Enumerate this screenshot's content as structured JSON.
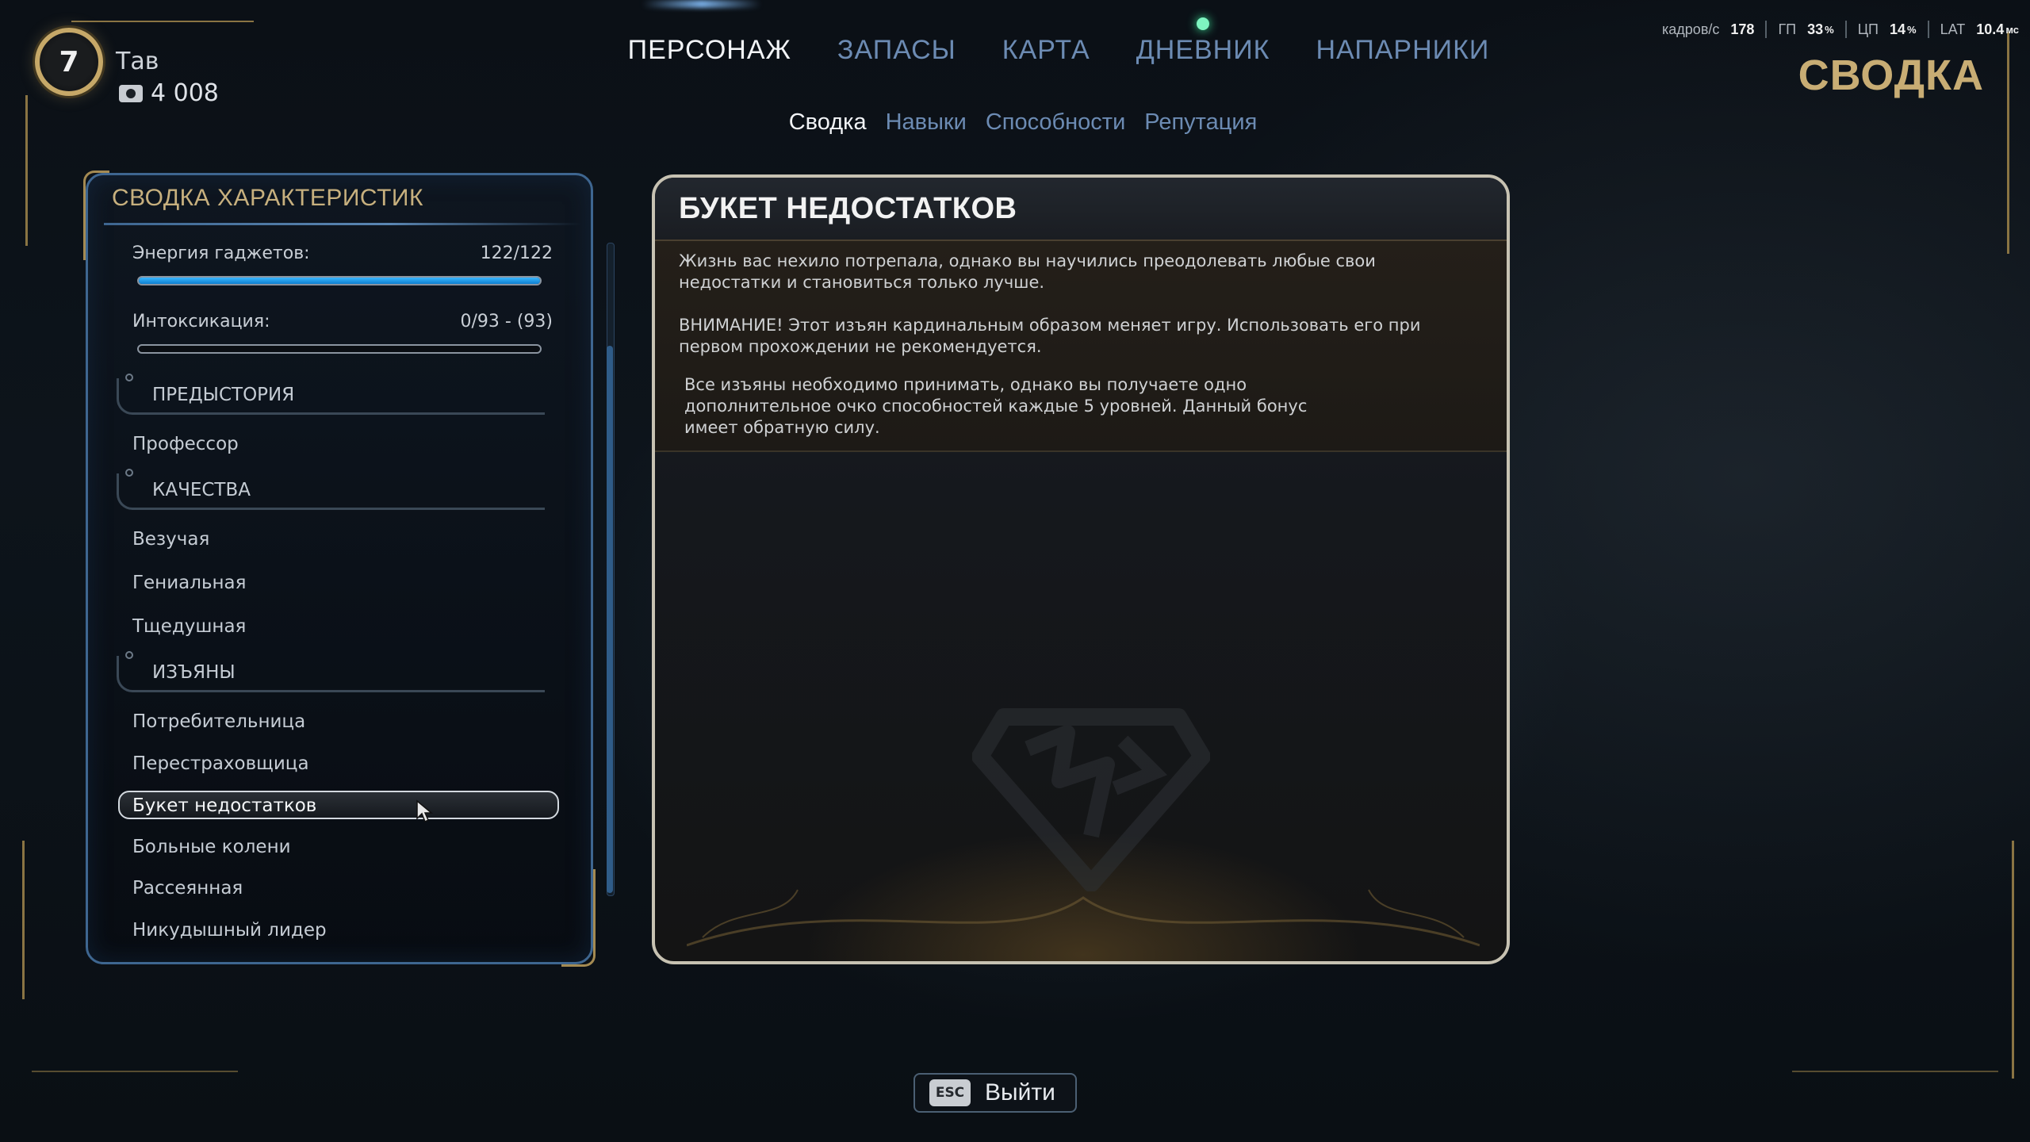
{
  "hud": {
    "level": "7",
    "character_name": "Тав",
    "money": "4 008"
  },
  "nav": {
    "tabs": [
      {
        "label": "ПЕРСОНАЖ",
        "active": true
      },
      {
        "label": "ЗАПАСЫ",
        "active": false
      },
      {
        "label": "КАРТА",
        "active": false
      },
      {
        "label": "ДНЕВНИК",
        "active": false,
        "notification": true
      },
      {
        "label": "НАПАРНИКИ",
        "active": false
      }
    ],
    "subtabs": [
      {
        "label": "Сводка",
        "active": true
      },
      {
        "label": "Навыки",
        "active": false
      },
      {
        "label": "Способности",
        "active": false
      },
      {
        "label": "Репутация",
        "active": false
      }
    ]
  },
  "page_title": "СВОДКА",
  "perf": {
    "fps_label": "кадров/с",
    "fps": "178",
    "gpu_label": "ГП",
    "gpu": "33",
    "cpu_label": "ЦП",
    "cpu": "14",
    "lat_label": "LAT",
    "lat": "10.4",
    "pct": "%",
    "ms": "мс"
  },
  "summary": {
    "header": "СВОДКА ХАРАКТЕРИСТИК",
    "gadget_energy": {
      "label": "Энергия гаджетов:",
      "value": "122/122",
      "fill": 1.0
    },
    "intoxication": {
      "label": "Интоксикация:",
      "value": "0/93 - (93)",
      "fill": 0.0
    },
    "sections": {
      "background": {
        "title": "ПРЕДЫСТОРИЯ",
        "items": [
          "Профессор"
        ]
      },
      "qualities": {
        "title": "КАЧЕСТВА",
        "items": [
          "Везучая",
          "Гениальная",
          "Тщедушная"
        ]
      },
      "flaws": {
        "title": "ИЗЪЯНЫ",
        "items": [
          "Потребительница",
          "Перестраховщица",
          "Букет недостатков",
          "Больные колени",
          "Рассеянная",
          "Никудышный лидер"
        ]
      }
    },
    "selected_item": "Букет недостатков"
  },
  "detail": {
    "title": "БУКЕТ НЕДОСТАТКОВ",
    "paragraph1": "Жизнь вас нехило потрепала, однако вы научились преодолевать любые свои недостатки и становиться только лучше.",
    "paragraph2": "ВНИМАНИЕ! Этот изъян кардинальным образом меняет игру. Использовать его при первом прохождении не рекомендуется.",
    "paragraph3_line1": "Все изъяны необходимо принимать, однако вы получаете одно",
    "paragraph3_line2": "дополнительное очко способностей каждые 5 уровней. Данный бонус",
    "paragraph3_line3": "имеет обратную силу."
  },
  "exit": {
    "key": "ESC",
    "label": "Выйти"
  },
  "colors": {
    "accent_gold": "#c8ad74",
    "accent_blue": "#6c8bb3",
    "energy_bar": "#39b6ff",
    "notification": "#7ef5c0"
  },
  "icons": [
    "money-icon",
    "cursor-icon",
    "flaw-emblem-icon"
  ]
}
